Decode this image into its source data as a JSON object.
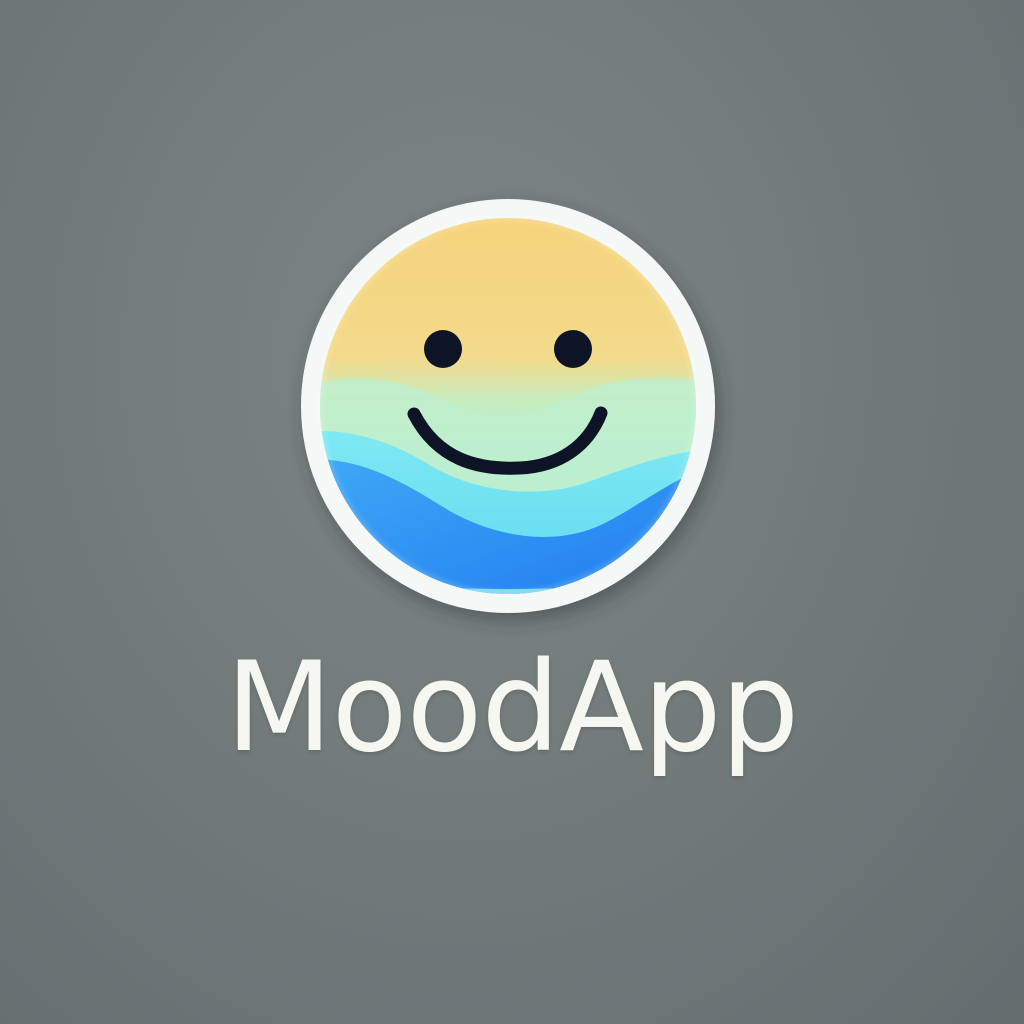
{
  "app": {
    "name": "MoodApp"
  },
  "logo": {
    "icon": "smiley-face-icon",
    "colors": {
      "background": "#737b7b",
      "ring": "#f4f8f6",
      "face_top": "#f6d881",
      "face_middle": "#b9ecc6",
      "wave_light": "#6ee4ee",
      "wave_deep": "#2d8ff0",
      "features": "#0d1426",
      "wordmark": "#f6f7f0"
    }
  }
}
